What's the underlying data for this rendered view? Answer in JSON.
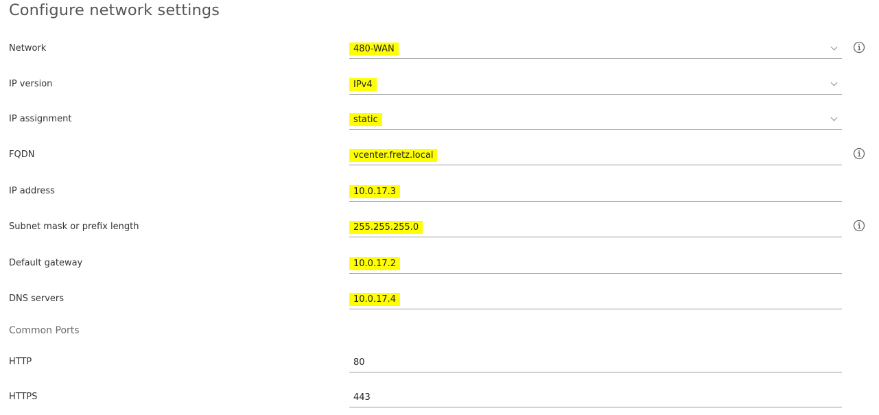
{
  "page": {
    "title": "Configure network settings"
  },
  "fields": [
    {
      "label": "Network",
      "value": "480-WAN"
    },
    {
      "label": "IP version",
      "value": "IPv4"
    },
    {
      "label": "IP assignment",
      "value": "static"
    },
    {
      "label": "FQDN",
      "value": "vcenter.fretz.local"
    },
    {
      "label": "IP address",
      "value": "10.0.17.3"
    },
    {
      "label": "Subnet mask or prefix length",
      "value": "255.255.255.0"
    },
    {
      "label": "Default gateway",
      "value": "10.0.17.2"
    },
    {
      "label": "DNS servers",
      "value": "10.0.17.4"
    }
  ],
  "ports_section": {
    "title": "Common Ports",
    "fields": [
      {
        "label": "HTTP",
        "value": "80"
      },
      {
        "label": "HTTPS",
        "value": "443"
      }
    ]
  },
  "icons": {
    "dropdown": "chevron-down-icon",
    "info": "info-icon"
  },
  "colors": {
    "highlight": "#ffff00",
    "underline": "#9a9a9a",
    "text": "#333333"
  }
}
